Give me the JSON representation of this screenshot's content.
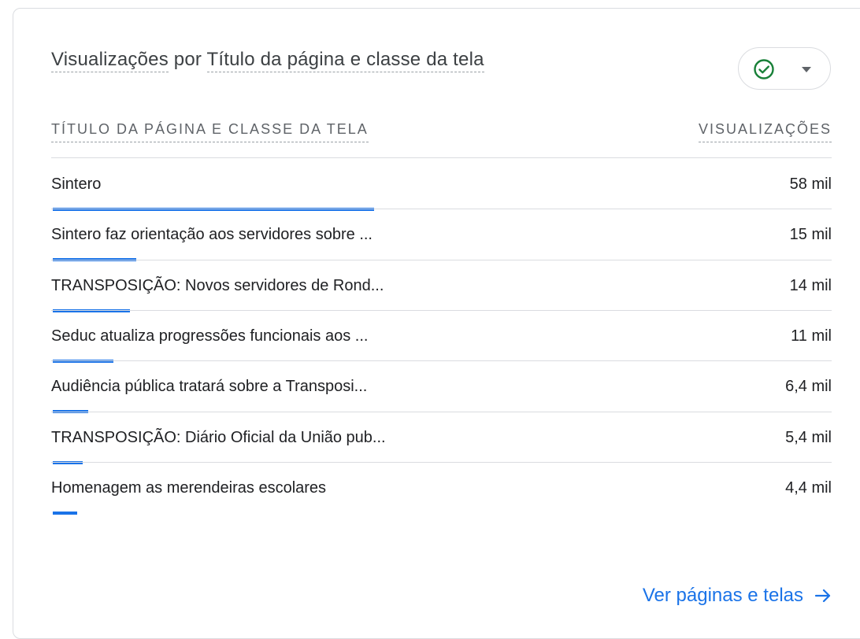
{
  "card": {
    "title_part1": "Visualizações",
    "title_connector": " por ",
    "title_part2": "Título da página e classe da tela",
    "status_icon": "check-circle-icon",
    "status_color": "#188038",
    "accent_color": "#1a73e8"
  },
  "table": {
    "col_title": "TÍTULO DA PÁGINA E CLASSE DA TELA",
    "col_views": "VISUALIZAÇÕES",
    "rows": [
      {
        "label": "Sintero",
        "value": "58 mil",
        "views": 58000
      },
      {
        "label": "Sintero faz orientação aos servidores sobre ...",
        "value": "15 mil",
        "views": 15000
      },
      {
        "label": "TRANSPOSIÇÃO: Novos servidores de Rond...",
        "value": "14 mil",
        "views": 14000
      },
      {
        "label": "Seduc atualiza progressões funcionais aos ...",
        "value": "11 mil",
        "views": 11000
      },
      {
        "label": "Audiência pública tratará sobre a Transposi...",
        "value": "6,4 mil",
        "views": 6400
      },
      {
        "label": "TRANSPOSIÇÃO: Diário Oficial da União pub...",
        "value": "5,4 mil",
        "views": 5400
      },
      {
        "label": "Homenagem as merendeiras escolares",
        "value": "4,4 mil",
        "views": 4400
      }
    ]
  },
  "footer": {
    "link_label": "Ver páginas e telas",
    "link_icon": "arrow-right-icon"
  }
}
